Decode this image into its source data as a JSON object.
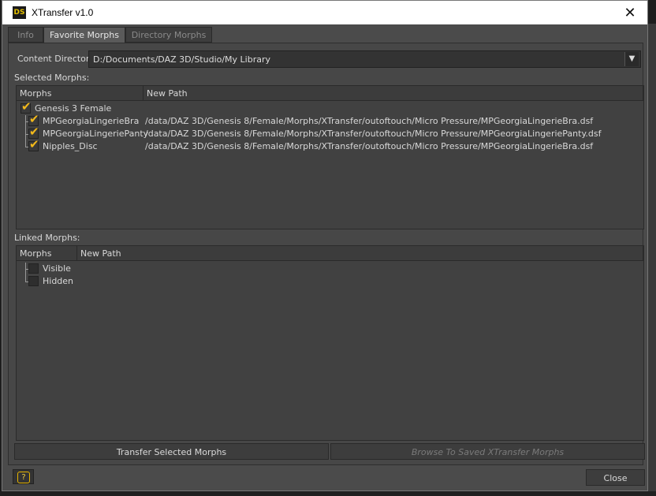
{
  "window": {
    "title": "XTransfer v1.0",
    "icon_label": "DS",
    "close_glyph": "✕"
  },
  "tabs": [
    {
      "label": "Info",
      "active": false
    },
    {
      "label": "Favorite Morphs",
      "active": true
    },
    {
      "label": "Directory Morphs",
      "active": false
    }
  ],
  "content_directory": {
    "label": "Content Directory:",
    "value": "D:/Documents/DAZ 3D/Studio/My Library"
  },
  "selected_morphs": {
    "label": "Selected Morphs:",
    "columns": [
      "Morphs",
      "New Path"
    ],
    "root": {
      "name": "Genesis 3 Female",
      "checked": true
    },
    "items": [
      {
        "name": "MPGeorgiaLingerieBra",
        "path": "/data/DAZ 3D/Genesis 8/Female/Morphs/XTransfer/outoftouch/Micro Pressure/MPGeorgiaLingerieBra.dsf",
        "checked": true
      },
      {
        "name": "MPGeorgiaLingeriePanty",
        "path": "/data/DAZ 3D/Genesis 8/Female/Morphs/XTransfer/outoftouch/Micro Pressure/MPGeorgiaLingeriePanty.dsf",
        "checked": true
      },
      {
        "name": "Nipples_Disc",
        "path": "/data/DAZ 3D/Genesis 8/Female/Morphs/XTransfer/outoftouch/Micro Pressure/MPGeorgiaLingerieBra.dsf",
        "checked": true
      }
    ]
  },
  "linked_morphs": {
    "label": "Linked Morphs:",
    "columns": [
      "Morphs",
      "New Path"
    ],
    "items": [
      {
        "name": "Visible",
        "checked": false
      },
      {
        "name": "Hidden",
        "checked": false
      }
    ]
  },
  "buttons": {
    "transfer": "Transfer Selected Morphs",
    "browse": "Browse To Saved XTransfer Morphs",
    "close": "Close",
    "help": "?"
  },
  "colors": {
    "accent_check": "#f2b91b",
    "panel": "#474747",
    "titlebar": "#ffffff"
  }
}
